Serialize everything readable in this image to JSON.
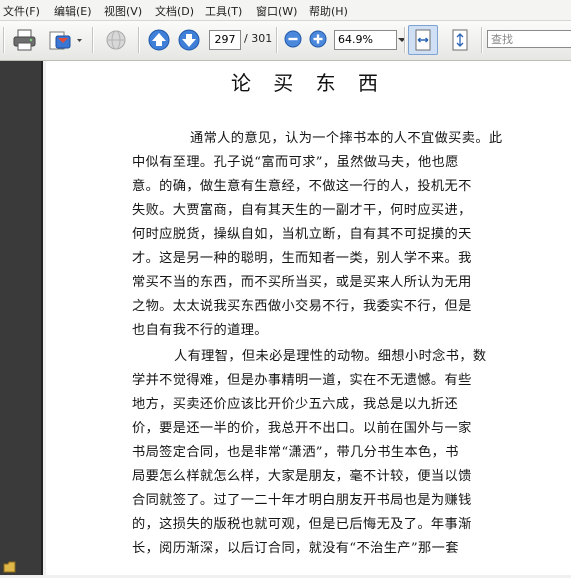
{
  "menu": {
    "items": [
      "文件(F)",
      "编辑(E)",
      "视图(V)",
      "文档(D)",
      "工具(T)",
      "窗口(W)",
      "帮助(H)"
    ]
  },
  "toolbar": {
    "current_page": "297",
    "total_pages": "/ 301",
    "zoom": "64.9%",
    "search_placeholder": "查找",
    "icons": [
      "print-icon",
      "share-icon",
      "page-up-icon",
      "page-down-icon",
      "zoom-out-icon",
      "zoom-in-icon",
      "fit-width-icon",
      "fit-page-icon"
    ]
  },
  "document": {
    "title": "论 买 东 西",
    "lines": [
      "通常人的意见，认为一个摔书本的人不宜做买卖。此",
      "中似有至理。孔子说“富而可求”，虽然做马夫，他也愿",
      "意。的确，做生意有生意经，不做这一行的人，投机无不",
      "失败。大贾富商，自有其天生的一副才干，何时应买进，",
      "何时应脱货，操纵自如，当机立断，自有其不可捉摸的天",
      "才。这是另一种的聪明，生而知者一类，别人学不来。我",
      "常买不当的东西，而不买所当买，或是买来人所认为无用",
      "之物。太太说我买东西做小交易不行，我委实不行，但是",
      "也自有我不行的道理。",
      "人有理智，但未必是理性的动物。细想小时念书，数",
      "学并不觉得难，但是办事精明一道，实在不无遗憾。有些",
      "地方，买卖还价应该比开价少五六成，我总是以九折还",
      "价，要是还一半的价，我总开不出口。以前在国外与一家",
      "书局签定合同，也是非常“潇洒”，带几分书生本色，书",
      "局要怎么样就怎么样，大家是朋友，毫不计较，便当以馈",
      "合同就签了。过了一二十年才明白朋友开书局也是为赚钱",
      "的，这损失的版税也就可观，但是已后悔无及了。年事渐",
      "长，阅历渐深，以后订合同，就没有“不治生产”那一套"
    ]
  }
}
